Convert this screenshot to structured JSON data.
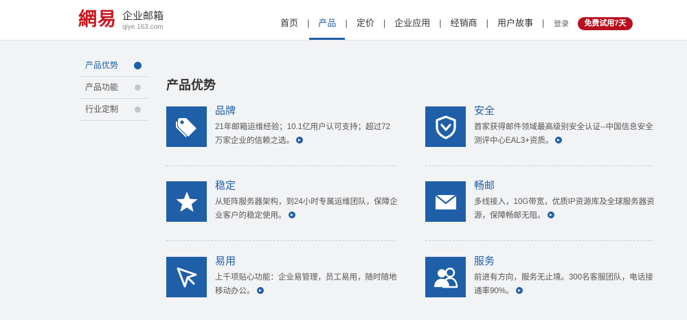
{
  "header": {
    "logo_mark": "網易",
    "logo_title": "企业邮箱",
    "logo_domain": "qiye.163.com",
    "nav": [
      {
        "label": "首页",
        "active": false
      },
      {
        "label": "产品",
        "active": true
      },
      {
        "label": "定价",
        "active": false
      },
      {
        "label": "企业应用",
        "active": false
      },
      {
        "label": "经销商",
        "active": false
      },
      {
        "label": "用户故事",
        "active": false
      }
    ],
    "separator": "|",
    "login": "登录",
    "trial_button": "免费试用7天"
  },
  "sidebar": {
    "items": [
      {
        "label": "产品优势",
        "active": true
      },
      {
        "label": "产品功能",
        "active": false
      },
      {
        "label": "行业定制",
        "active": false
      }
    ]
  },
  "main": {
    "title": "产品优势",
    "features": [
      {
        "title": "品牌",
        "desc": "21年邮箱运维经验；10.1亿用户认可支持；超过72万家企业的信赖之选。",
        "icon": "tag-icon"
      },
      {
        "title": "安全",
        "desc": "首家获得邮件领域最高级别安全认证--中国信息安全测评中心EAL3+资质。",
        "icon": "shield-icon"
      },
      {
        "title": "稳定",
        "desc": "从矩阵服务器架构，到24小时专属运维团队，保障企业客户的稳定使用。",
        "icon": "star-icon"
      },
      {
        "title": "畅邮",
        "desc": "多线接入，10G带宽，优质IP资源库及全球服务器资源，保障畅邮无阻。",
        "icon": "envelope-icon"
      },
      {
        "title": "易用",
        "desc": "上千项贴心功能：企业易管理，员工易用，随时随地移动办公。",
        "icon": "cursor-icon"
      },
      {
        "title": "服务",
        "desc": "前进有方向，服务无止境。300名客服团队，电话接通率90%。",
        "icon": "users-icon"
      }
    ]
  },
  "colors": {
    "accent": "#1f5fa8",
    "brand_red": "#c8161d",
    "trial_red": "#b8101f",
    "background": "#f2f3f5"
  }
}
